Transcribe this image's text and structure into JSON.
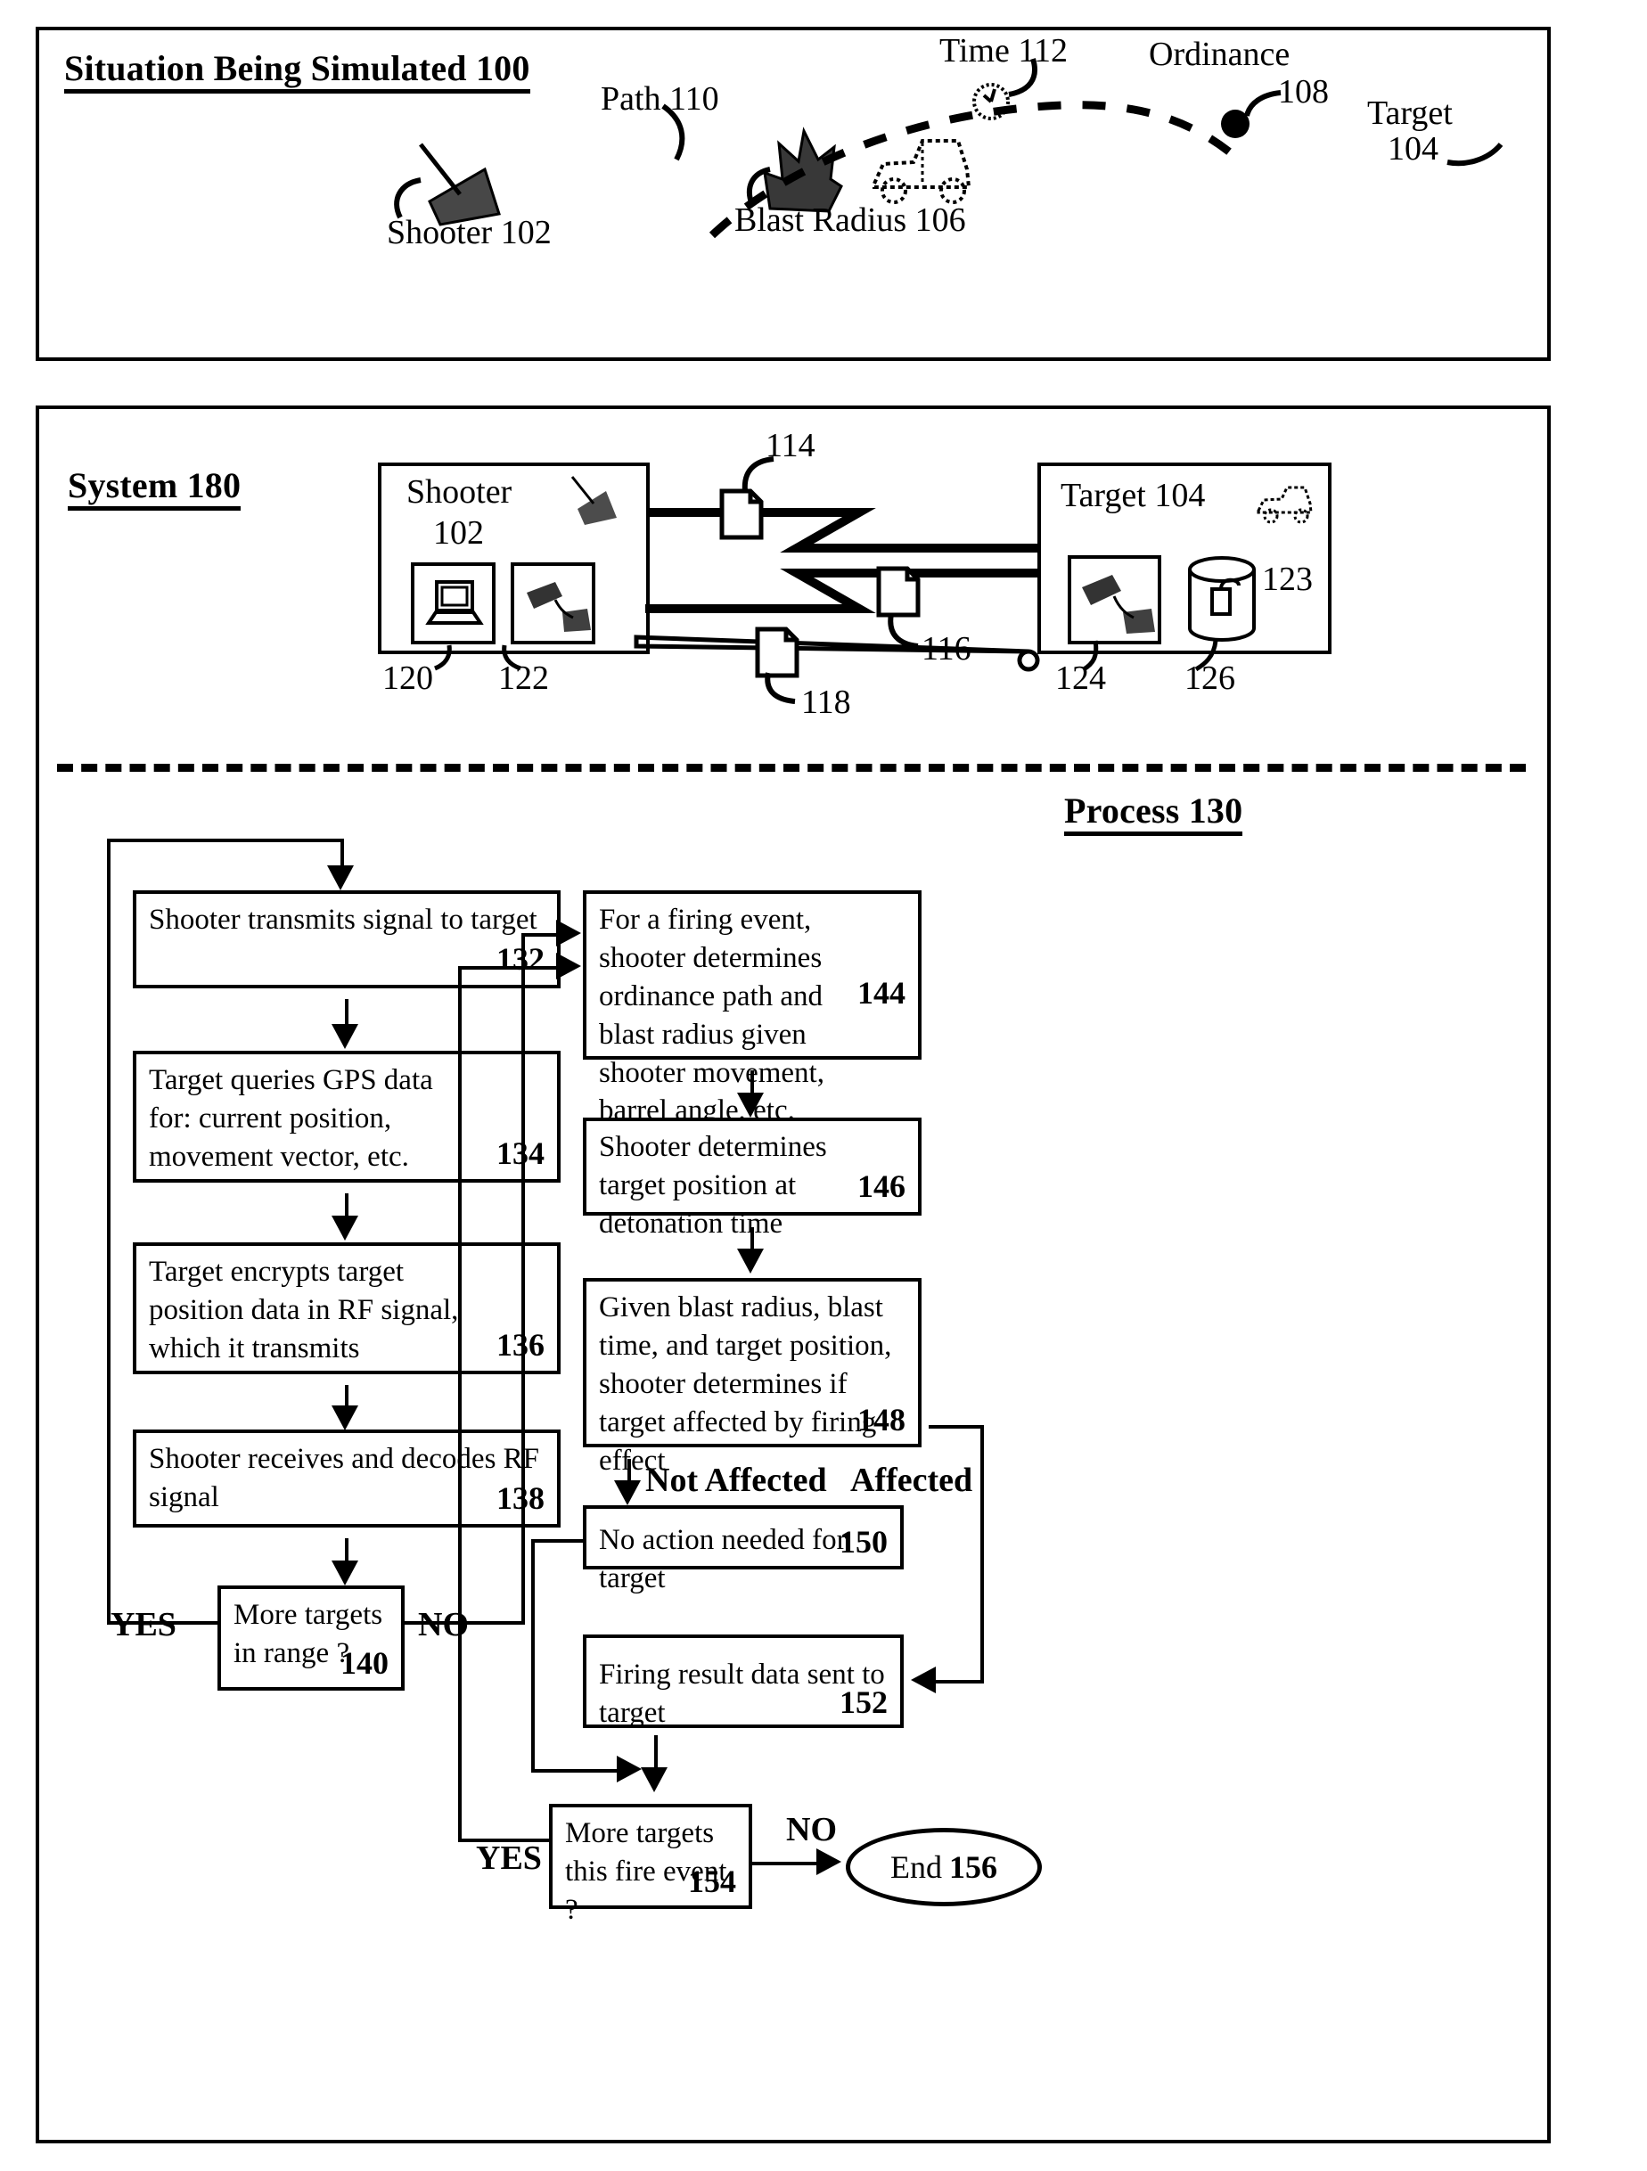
{
  "figure": {
    "top_panel": {
      "heading": "Situation Being Simulated 100",
      "labels": {
        "path": "Path 110",
        "time": "Time 112",
        "ordinance": "Ordinance",
        "ordinance_num": "108",
        "target": "Target",
        "target_num": "104",
        "shooter": "Shooter 102",
        "blast_radius": "Blast Radius 106"
      },
      "icons": [
        "artillery-icon",
        "clock-icon",
        "ordinance-dot-icon",
        "explosion-icon",
        "vehicle-icon"
      ]
    },
    "system_panel": {
      "heading": "System 180",
      "shooter_box": {
        "title_line1": "Shooter",
        "title_line2": "102",
        "sub1_num": "120",
        "sub2_num": "122",
        "sub1_icon": "laptop-icon",
        "sub2_icon": "artillery-icon"
      },
      "target_box": {
        "title": "Target 104",
        "sub1_num": "124",
        "sub2_num": "126",
        "sub3_num": "123",
        "sub1_icon": "artillery-icon",
        "sub2_icon": "database-cylinder-icon",
        "title_icon": "vehicle-icon"
      },
      "signals": [
        {
          "num": "114",
          "icon": "document-icon",
          "kind": "rf-zigzag"
        },
        {
          "num": "116",
          "icon": "document-icon",
          "kind": "rf-zigzag"
        },
        {
          "num": "118",
          "icon": "document-icon",
          "kind": "laser-cone"
        }
      ]
    },
    "process": {
      "heading": "Process 130",
      "left_column": [
        {
          "text": "Shooter transmits signal to target",
          "num": "132"
        },
        {
          "text": "Target queries GPS data for: current position, movement vector, etc.",
          "num": "134"
        },
        {
          "text": "Target encrypts target position data in RF signal, which it transmits",
          "num": "136"
        },
        {
          "text": "Shooter receives and decodes RF signal",
          "num": "138"
        },
        {
          "text": "More targets in range ?",
          "num": "140"
        }
      ],
      "right_column": [
        {
          "text": "For a firing event, shooter determines ordinance path and blast radius given shooter movement, barrel angle, etc.",
          "num": "144"
        },
        {
          "text": "Shooter determines target position at detonation time",
          "num": "146"
        },
        {
          "text": "Given blast radius, blast time, and target position, shooter determines if target affected by firing effect",
          "num": "148"
        },
        {
          "text": "No action needed for target",
          "num": "150"
        },
        {
          "text": "Firing result data sent to target",
          "num": "152"
        },
        {
          "text": "More targets this fire event ?",
          "num": "154"
        }
      ],
      "terminator": {
        "text": "End",
        "num": "156"
      },
      "edge_labels": {
        "yes_140": "YES",
        "no_140": "NO",
        "not_affected": "Not Affected",
        "affected": "Affected",
        "yes_154": "YES",
        "no_154": "NO"
      }
    }
  },
  "colors": {
    "ink": "#000000",
    "paper": "#ffffff"
  }
}
